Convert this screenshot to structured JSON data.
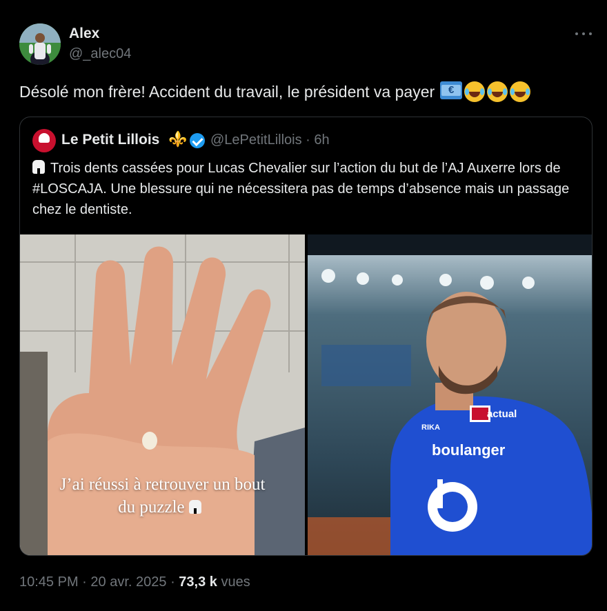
{
  "author": {
    "name": "Alex",
    "handle": "@_alec04",
    "avatar_icon": "profile-photo"
  },
  "tweet": {
    "text": "Désolé mon frère! Accident du travail, le président va payer",
    "emojis": [
      "money-bill-emoji",
      "laughing-emoji",
      "laughing-emoji",
      "laughing-emoji"
    ]
  },
  "quoted_tweet": {
    "name": "Le Petit Lillois",
    "name_emoji": "⚜️",
    "handle": "@LePetitLillois",
    "separator": "·",
    "time": "6h",
    "text": "Trois dents cassées pour Lucas Chevalier sur l’action du but de l’AJ Auxerre lors de #LOSCAJA. Une blessure qui ne nécessitera pas de temps d’absence mais un passage chez le dentiste.",
    "media": {
      "left_caption_line1": "J’ai réussi à retrouver un bout",
      "left_caption_line2": "du puzzle",
      "right_shirt_sponsor": "boulanger",
      "right_shirt_brand": "actual",
      "right_shirt_kit": "RIKA"
    }
  },
  "footer": {
    "time": "10:45 PM",
    "sep1": "·",
    "date": "20 avr. 2025",
    "sep2": "·",
    "views_count": "73,3 k",
    "views_label": "vues"
  },
  "colors": {
    "background": "#000000",
    "text": "#e7e9ea",
    "muted": "#71767b",
    "border": "#2f3336",
    "verified": "#1d9bf0",
    "shirt": "#1f4fd1"
  }
}
